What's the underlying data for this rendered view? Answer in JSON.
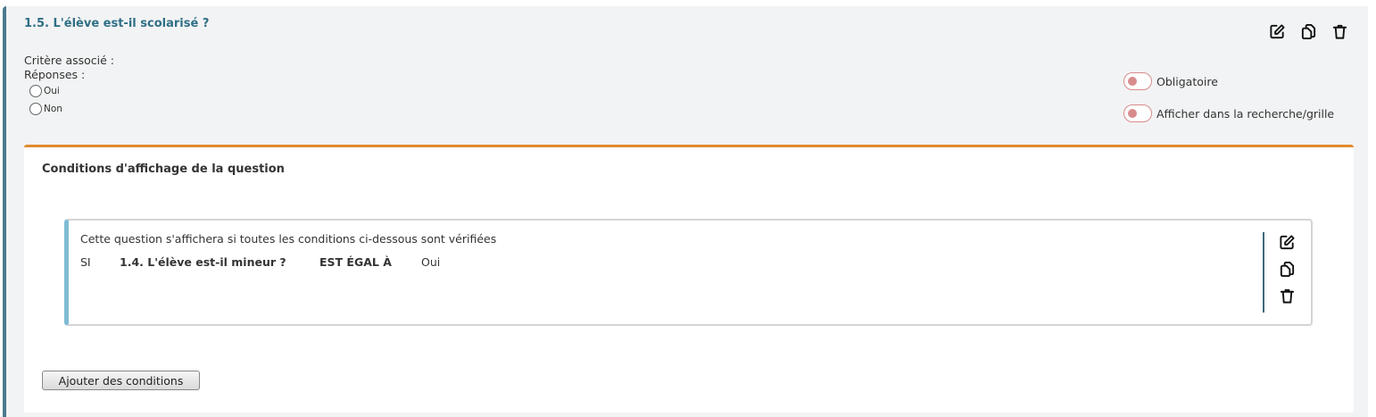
{
  "question": {
    "title": "1.5. L'élève est-il scolarisé ?",
    "criterion_label": "Critère associé :",
    "responses_label": "Réponses :",
    "responses": [
      "Oui",
      "Non"
    ]
  },
  "actions": {
    "icons": [
      "edit-icon",
      "copy-icon",
      "trash-icon"
    ]
  },
  "toggles": {
    "mandatory": "Obligatoire",
    "show_in_search": "Afficher dans la recherche/grille"
  },
  "conditions": {
    "title": "Conditions d'affichage de la question",
    "description": "Cette question s'affichera si toutes les conditions ci-dessous sont vérifiées",
    "rule": {
      "keyword": "SI",
      "question": "1.4. L'élève est-il mineur ?",
      "operator": "EST ÉGAL À",
      "value": "Oui"
    },
    "add_button": "Ajouter des conditions"
  },
  "colors": {
    "accent_left": "#4a7b8c",
    "title_teal": "#2f6f86",
    "panel_orange": "#e08a2e",
    "toggle_red": "#d88c8c",
    "cond_blue": "#7fbcd4"
  }
}
